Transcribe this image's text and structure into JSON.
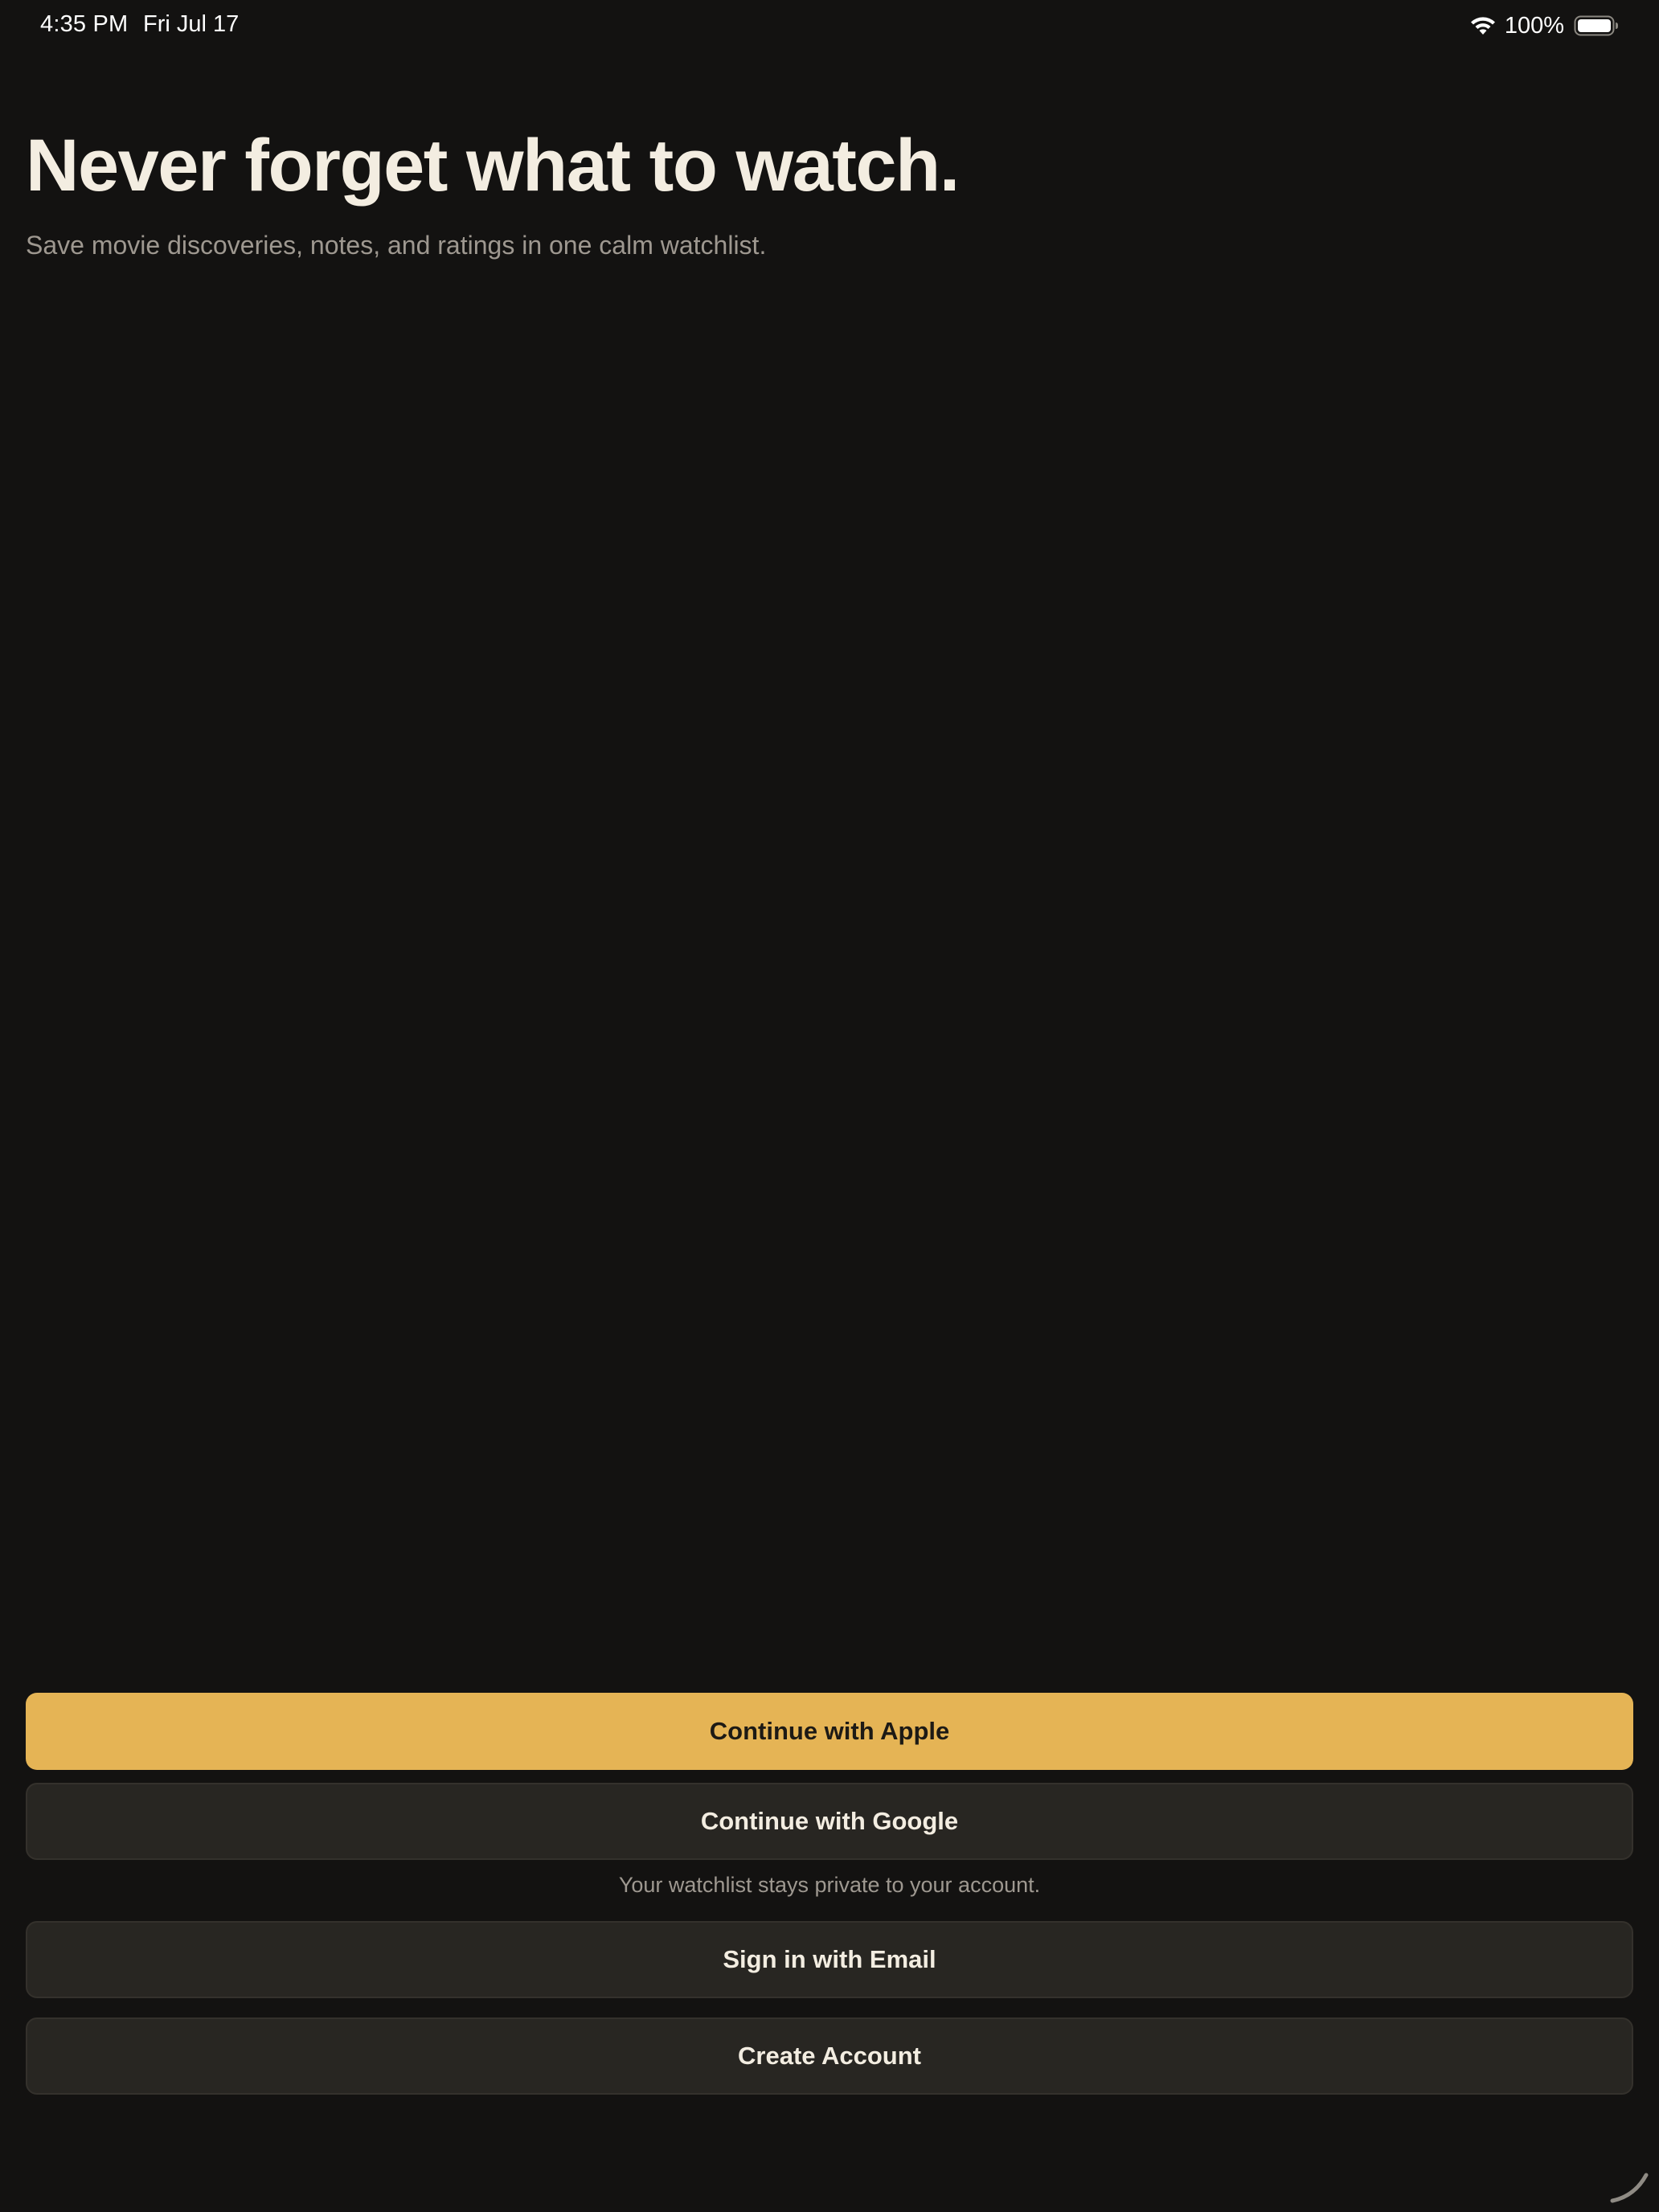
{
  "status_bar": {
    "time": "4:35 PM",
    "date": "Fri Jul 17",
    "battery": "100%",
    "icons": [
      "wifi-icon",
      "battery-icon"
    ]
  },
  "hero": {
    "title": "Never forget what to watch.",
    "subtitle": "Save movie discoveries, notes, and ratings in one calm watchlist."
  },
  "auth": {
    "apple_label": "Continue with Apple",
    "google_label": "Continue with Google",
    "privacy_note": "Your watchlist stays private to your account.",
    "email_label": "Sign in with Email",
    "create_label": "Create Account"
  },
  "colors": {
    "background": "#131211",
    "accent": "#e5b455",
    "secondary_button": "#282622",
    "text_primary": "#f3ede1",
    "text_muted": "#9e9890"
  }
}
